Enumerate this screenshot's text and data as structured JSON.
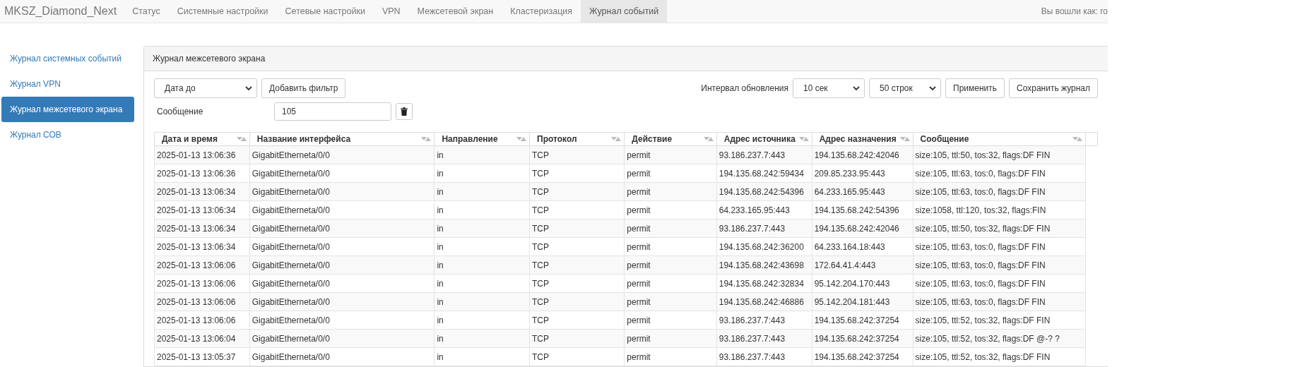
{
  "navbar": {
    "brand": "MKSZ_Diamond_Next",
    "items": [
      {
        "label": "Статус",
        "selected": false
      },
      {
        "label": "Системные настройки",
        "selected": false
      },
      {
        "label": "Сетевые настройки",
        "selected": false
      },
      {
        "label": "VPN",
        "selected": false
      },
      {
        "label": "Межсетевой экран",
        "selected": false
      },
      {
        "label": "Кластеризация",
        "selected": false
      },
      {
        "label": "Журнал событий",
        "selected": true
      }
    ],
    "user": "Вы вошли как: ro"
  },
  "sidebar": {
    "items": [
      {
        "label": "Журнал системных событий",
        "selected": false
      },
      {
        "label": "Журнал VPN",
        "selected": false
      },
      {
        "label": "Журнал межсетевого экрана",
        "selected": true
      },
      {
        "label": "Журнал СОВ",
        "selected": false
      }
    ]
  },
  "panel": {
    "title": "Журнал межсетевого экрана",
    "filter_select": "Дата до",
    "add_filter_button": "Добавить фильтр",
    "refresh_label": "Интервал обновления",
    "interval_select": "10 сек",
    "rows_select": "50 строк",
    "apply_button": "Применить",
    "save_button": "Сохранить журнал",
    "filters": [
      {
        "label": "Сообщение",
        "value": "105"
      }
    ]
  },
  "table": {
    "columns": [
      "Дата и время",
      "Название интерфейса",
      "Направление",
      "Протокол",
      "Действие",
      "Адрес источника",
      "Адрес назначения",
      "Сообщение"
    ],
    "rows": [
      [
        "2025-01-13 13:06:36",
        "GigabitEtherneta/0/0",
        "in",
        "TCP",
        "permit",
        "93.186.237.7:443",
        "194.135.68.242:42046",
        "size:105, ttl:50, tos:32, flags:DF FIN"
      ],
      [
        "2025-01-13 13:06:36",
        "GigabitEtherneta/0/0",
        "in",
        "TCP",
        "permit",
        "194.135.68.242:59434",
        "209.85.233.95:443",
        "size:105, ttl:63, tos:0, flags:DF FIN"
      ],
      [
        "2025-01-13 13:06:34",
        "GigabitEtherneta/0/0",
        "in",
        "TCP",
        "permit",
        "194.135.68.242:54396",
        "64.233.165.95:443",
        "size:105, ttl:63, tos:0, flags:DF FIN"
      ],
      [
        "2025-01-13 13:06:34",
        "GigabitEtherneta/0/0",
        "in",
        "TCP",
        "permit",
        "64.233.165.95:443",
        "194.135.68.242:54396",
        "size:1058, ttl:120, tos:32, flags:FIN"
      ],
      [
        "2025-01-13 13:06:34",
        "GigabitEtherneta/0/0",
        "in",
        "TCP",
        "permit",
        "93.186.237.7:443",
        "194.135.68.242:42046",
        "size:105, ttl:50, tos:32, flags:DF FIN"
      ],
      [
        "2025-01-13 13:06:34",
        "GigabitEtherneta/0/0",
        "in",
        "TCP",
        "permit",
        "194.135.68.242:36200",
        "64.233.164.18:443",
        "size:105, ttl:63, tos:0, flags:DF FIN"
      ],
      [
        "2025-01-13 13:06:06",
        "GigabitEtherneta/0/0",
        "in",
        "TCP",
        "permit",
        "194.135.68.242:43698",
        "172.64.41.4:443",
        "size:105, ttl:63, tos:0, flags:DF FIN"
      ],
      [
        "2025-01-13 13:06:06",
        "GigabitEtherneta/0/0",
        "in",
        "TCP",
        "permit",
        "194.135.68.242:32834",
        "95.142.204.170:443",
        "size:105, ttl:63, tos:0, flags:DF FIN"
      ],
      [
        "2025-01-13 13:06:06",
        "GigabitEtherneta/0/0",
        "in",
        "TCP",
        "permit",
        "194.135.68.242:46886",
        "95.142.204.181:443",
        "size:105, ttl:63, tos:0, flags:DF FIN"
      ],
      [
        "2025-01-13 13:06:06",
        "GigabitEtherneta/0/0",
        "in",
        "TCP",
        "permit",
        "93.186.237.7:443",
        "194.135.68.242:37254",
        "size:105, ttl:52, tos:32, flags:DF FIN"
      ],
      [
        "2025-01-13 13:06:04",
        "GigabitEtherneta/0/0",
        "in",
        "TCP",
        "permit",
        "93.186.237.7:443",
        "194.135.68.242:37254",
        "size:105, ttl:52, tos:32, flags:DF @-? ?"
      ],
      [
        "2025-01-13 13:05:37",
        "GigabitEtherneta/0/0",
        "in",
        "TCP",
        "permit",
        "93.186.237.7:443",
        "194.135.68.242:37254",
        "size:105, ttl:52, tos:32, flags:DF FIN"
      ]
    ]
  }
}
